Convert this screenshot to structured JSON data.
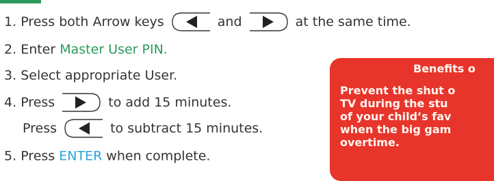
{
  "steps": {
    "s1": {
      "num": "1.",
      "before": "Press both Arrow keys",
      "middle": "and",
      "after": "at the same time."
    },
    "s2": {
      "num": "2.",
      "before": "Enter ",
      "highlight": "Master User PIN."
    },
    "s3": {
      "num": "3.",
      "text": "Select appropriate User."
    },
    "s4": {
      "num": "4.",
      "before": "Press",
      "after": "to add 15 minutes."
    },
    "s4b": {
      "before": "Press",
      "after": "to subtract 15 minutes."
    },
    "s5": {
      "num": "5.",
      "before": "Press ",
      "highlight": "ENTER",
      "after": " when complete."
    }
  },
  "icons": {
    "left": "left-arrow-key-icon",
    "right": "right-arrow-key-icon"
  },
  "callout": {
    "title": "Benefits o",
    "body": "Prevent the shut o\nTV during the stu\nof your child’s fav\nwhen the big gam\novertime."
  },
  "colors": {
    "green": "#2b9a5c",
    "blue": "#29a3dd",
    "callout_bg": "#e8352b",
    "text": "#333333"
  }
}
